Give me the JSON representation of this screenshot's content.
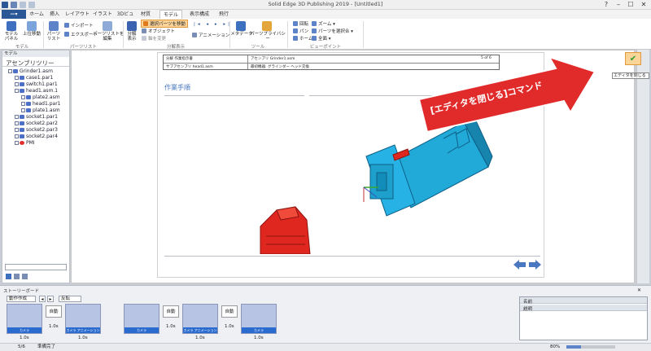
{
  "app": {
    "title": "Solid Edge 3D Publishing 2019 - [Untitled1]"
  },
  "window_controls": [
    "?",
    "–",
    "☐",
    "✕"
  ],
  "tabs": [
    "ホーム",
    "挿入",
    "レイアウト",
    "イラスト",
    "3Dビュー",
    "材質",
    "モデル",
    "表示構成",
    "飛行"
  ],
  "ribbon": {
    "model_panel": "モデル\nパネル",
    "move_up": "上位移動",
    "parts_list": "パーツ\nリスト",
    "import": "インポート",
    "export": "エクスポート",
    "edit_parts_list": "パーツリストを\n編集",
    "explode": "分解\n表示",
    "selected_parts_move": "選択パーツを移動",
    "object_offset": "オブジェクト",
    "axis_change": "軸を変更",
    "animation": "アニメーション",
    "metadata": "メタデータ",
    "parts_privacy": "パーツプライバシー",
    "rotate": "回転",
    "pan": "パン",
    "home": "ホーム",
    "zoom": "ズーム",
    "parts_fit": "パーツを選択合",
    "fit_all": "全面",
    "groups": [
      "モデル",
      "パーツリスト",
      "分解表示",
      "ツール",
      "ビューポイント"
    ]
  },
  "left_panel": {
    "header": "モデル",
    "title": "アセンブリツリー",
    "nodes": [
      {
        "label": "Grinder1.asm",
        "depth": 0
      },
      {
        "label": "case1.par1",
        "depth": 1
      },
      {
        "label": "switch1.par1",
        "depth": 1
      },
      {
        "label": "head1.asm.1",
        "depth": 1
      },
      {
        "label": "plate2.asm",
        "depth": 2
      },
      {
        "label": "head1.par1",
        "depth": 2
      },
      {
        "label": "plate1.asm",
        "depth": 2
      },
      {
        "label": "socket1.par1",
        "depth": 1
      },
      {
        "label": "socket2.par2",
        "depth": 1
      },
      {
        "label": "socket2.par3",
        "depth": 1
      },
      {
        "label": "socket2.par4",
        "depth": 1
      },
      {
        "label": "PMI",
        "depth": 1
      }
    ]
  },
  "document": {
    "header_cells": [
      "分解 作業指示書",
      "アセンブリ Grinder1.asm",
      "5 of 6",
      "サブアセンブリ head1.asm",
      "最初機器: グラインダー ヘッド交換"
    ],
    "section_title": "作業手順"
  },
  "callout": {
    "text": "[エディタを閉じる]コマンド"
  },
  "right_bar": {
    "tooltip": "エディタを閉じる"
  },
  "storyboard": {
    "header": "ストーリーボード",
    "create": "動作作成",
    "reverse": "反転",
    "steps": [
      "自動",
      "自動",
      "自動"
    ],
    "times": [
      "1.0s",
      "1.0s",
      "1.0s",
      "1.0s",
      "1.0s",
      "1.0s",
      "1.0s"
    ],
    "frame_labels": [
      "カメラ",
      "カメラ アニメーション",
      "カメラ",
      "カメラ アニメーション",
      "カメラ"
    ]
  },
  "props": {
    "name_label": "名前",
    "desc_label": "説明"
  },
  "status": {
    "page": "5/6",
    "ready": "準備完了",
    "zoom": "80%"
  },
  "colors": {
    "accent": "#2b5797",
    "highlight": "#ff8c00",
    "tool_blue": "#21a9d8",
    "part_red": "#e0271f",
    "callout_red": "#e12a2a"
  }
}
